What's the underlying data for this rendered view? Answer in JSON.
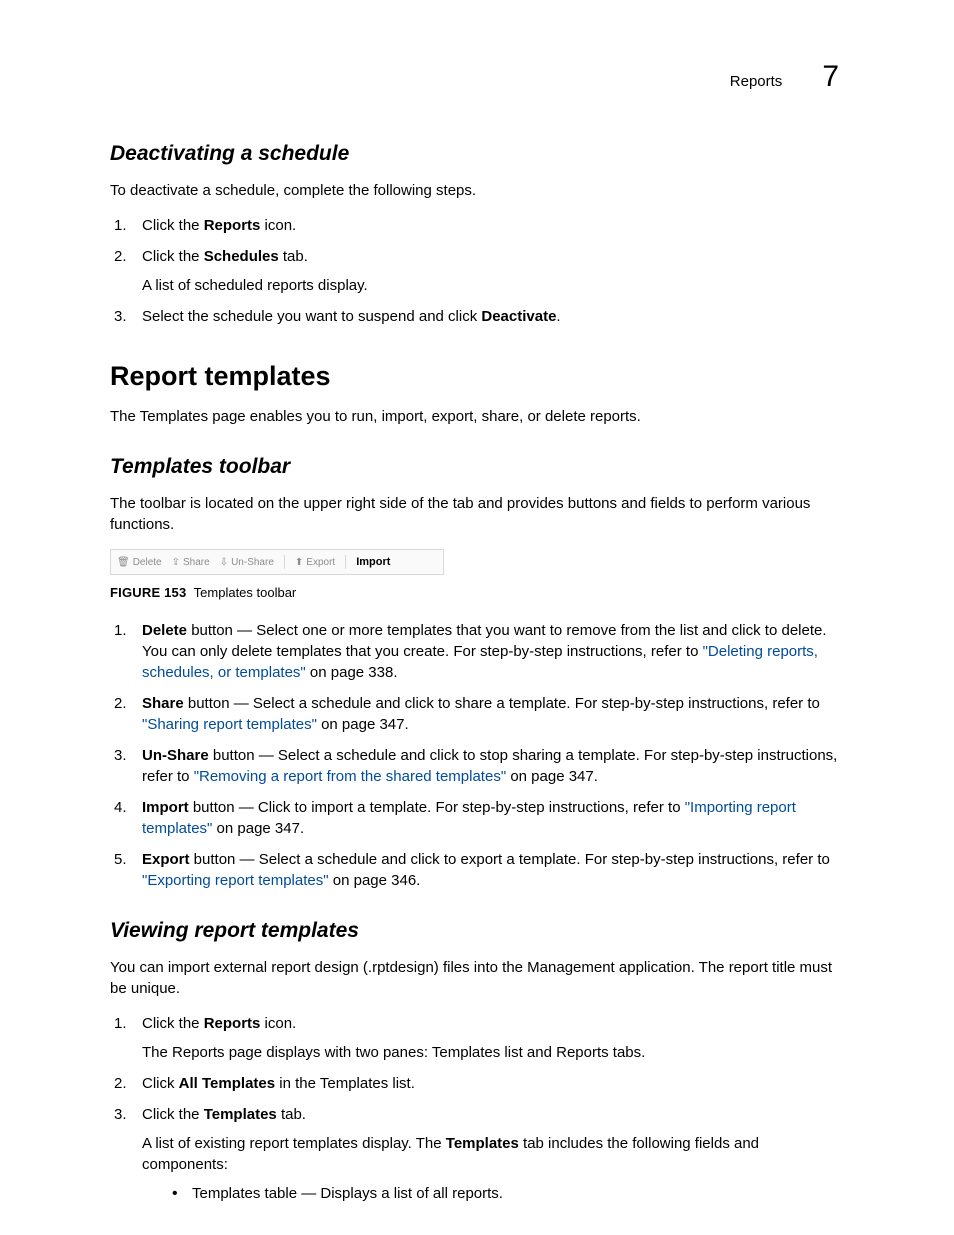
{
  "header": {
    "section": "Reports",
    "chapter": "7"
  },
  "sec1": {
    "title": "Deactivating a schedule",
    "intro": "To deactivate a schedule, complete the following steps.",
    "steps": {
      "s1a": "Click the ",
      "s1b": "Reports",
      "s1c": " icon.",
      "s2a": "Click the ",
      "s2b": "Schedules",
      "s2c": " tab.",
      "s2sub": "A list of scheduled reports display.",
      "s3a": "Select the schedule you want to suspend and click ",
      "s3b": "Deactivate",
      "s3c": "."
    }
  },
  "sec2": {
    "title": "Report templates",
    "intro": "The Templates page enables you to run, import, export, share, or delete reports."
  },
  "sec3": {
    "title": "Templates toolbar",
    "intro": "The toolbar is located on the upper right side of the tab and provides buttons and fields to perform various functions.",
    "toolbar": {
      "delete": "Delete",
      "share": "Share",
      "unshare": "Un-Share",
      "export": "Export",
      "import": "Import"
    },
    "caption_label": "FIGURE 153",
    "caption_text": "Templates toolbar",
    "items": {
      "i1_b": "Delete",
      "i1_t1": " button — Select one or more templates that you want to remove from the list and click to delete. You can only delete templates that you create. For step-by-step instructions, refer to ",
      "i1_l": "\"Deleting reports, schedules, or templates\"",
      "i1_t2": " on page 338.",
      "i2_b": "Share",
      "i2_t1": " button — Select a schedule and click to share a template. For step-by-step instructions, refer to ",
      "i2_l": "\"Sharing report templates\"",
      "i2_t2": " on page 347.",
      "i3_b": "Un-Share",
      "i3_t1": " button — Select a schedule and click to stop sharing a template. For step-by-step instructions, refer to ",
      "i3_l": "\"Removing a report from the shared templates\"",
      "i3_t2": " on page 347.",
      "i4_b": "Import",
      "i4_t1": " button — Click to import a template. For step-by-step instructions, refer to ",
      "i4_l": "\"Importing report templates\"",
      "i4_t2": " on page 347.",
      "i5_b": "Export",
      "i5_t1": " button — Select a schedule and click to export a template. For step-by-step instructions, refer to ",
      "i5_l": "\"Exporting report templates\"",
      "i5_t2": " on page 346."
    }
  },
  "sec4": {
    "title": "Viewing report templates",
    "intro": "You can import external report design (.rptdesign) files into the Management application. The report title must be unique.",
    "steps": {
      "s1a": "Click the ",
      "s1b": "Reports",
      "s1c": " icon.",
      "s1sub": "The Reports page displays with two panes: Templates list and Reports tabs.",
      "s2a": "Click ",
      "s2b": "All Templates",
      "s2c": " in the Templates list.",
      "s3a": "Click the ",
      "s3b": "Templates",
      "s3c": " tab.",
      "s3sub_a": "A list of existing report templates display. The ",
      "s3sub_b": "Templates",
      "s3sub_c": " tab includes the following fields and components:",
      "bullet1": "Templates table — Displays a list of all reports."
    }
  }
}
